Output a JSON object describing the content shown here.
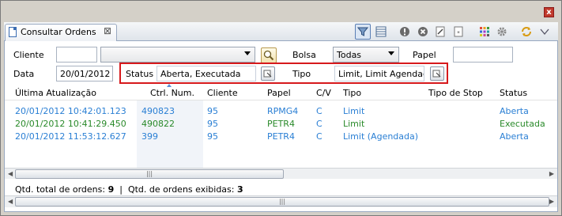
{
  "tab": {
    "label": "Consultar Ordens"
  },
  "filters": {
    "cliente_label": "Cliente",
    "cliente_value": "",
    "cliente_combo_value": "",
    "bolsa_label": "Bolsa",
    "bolsa_value": "Todas",
    "papel_label": "Papel",
    "papel_value": "",
    "data_label": "Data",
    "data_value": "20/01/2012",
    "status_label": "Status",
    "status_value": "Aberta, Executada",
    "tipo_label": "Tipo",
    "tipo_value": "Limit, Limit Agendad"
  },
  "table": {
    "columns": [
      "Última Atualização",
      "Ctrl. Num.",
      "Cliente",
      "Papel",
      "C/V",
      "Tipo",
      "Tipo de Stop",
      "Status"
    ],
    "rows": [
      {
        "updated": "20/01/2012 10:42:01.123",
        "ctrl": "490823",
        "cliente": "95",
        "papel": "RPMG4",
        "cv": "C",
        "tipo": "Limit",
        "stop": "",
        "status": "Aberta",
        "color": "#2a7fd4"
      },
      {
        "updated": "20/01/2012 10:41:29.450",
        "ctrl": "490822",
        "cliente": "95",
        "papel": "PETR4",
        "cv": "C",
        "tipo": "Limit",
        "stop": "",
        "status": "Executada",
        "color": "#2a8a2a"
      },
      {
        "updated": "20/01/2012 11:53:12.627",
        "ctrl": "399",
        "cliente": "95",
        "papel": "PETR4",
        "cv": "C",
        "tipo": "Limit (Agendada)",
        "stop": "",
        "status": "Aberta",
        "color": "#2a7fd4"
      }
    ]
  },
  "status_bar": {
    "total_label": "Qtd. total de ordens:",
    "total_value": "9",
    "separator": "|",
    "shown_label": "Qtd. de ordens exibidas:",
    "shown_value": "3"
  },
  "icons": {
    "filter": "filter-icon",
    "layout": "layout-icon",
    "info": "info-icon",
    "cancel": "cancel-icon",
    "edit": "edit-icon",
    "document": "document-icon",
    "grid": "grid-icon",
    "settings": "gear-icon",
    "refresh": "refresh-icon",
    "menu": "view-menu-icon"
  },
  "colors": {
    "highlight": "#d7191c",
    "open": "#2a7fd4",
    "executed": "#2a8a2a"
  }
}
